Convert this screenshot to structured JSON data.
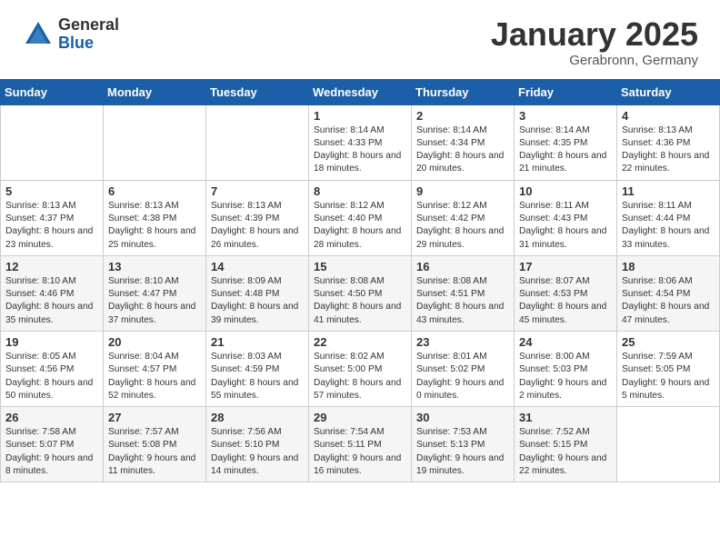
{
  "header": {
    "logo_general": "General",
    "logo_blue": "Blue",
    "month": "January 2025",
    "location": "Gerabronn, Germany"
  },
  "days_of_week": [
    "Sunday",
    "Monday",
    "Tuesday",
    "Wednesday",
    "Thursday",
    "Friday",
    "Saturday"
  ],
  "weeks": [
    [
      {
        "num": "",
        "info": ""
      },
      {
        "num": "",
        "info": ""
      },
      {
        "num": "",
        "info": ""
      },
      {
        "num": "1",
        "info": "Sunrise: 8:14 AM\nSunset: 4:33 PM\nDaylight: 8 hours and 18 minutes."
      },
      {
        "num": "2",
        "info": "Sunrise: 8:14 AM\nSunset: 4:34 PM\nDaylight: 8 hours and 20 minutes."
      },
      {
        "num": "3",
        "info": "Sunrise: 8:14 AM\nSunset: 4:35 PM\nDaylight: 8 hours and 21 minutes."
      },
      {
        "num": "4",
        "info": "Sunrise: 8:13 AM\nSunset: 4:36 PM\nDaylight: 8 hours and 22 minutes."
      }
    ],
    [
      {
        "num": "5",
        "info": "Sunrise: 8:13 AM\nSunset: 4:37 PM\nDaylight: 8 hours and 23 minutes."
      },
      {
        "num": "6",
        "info": "Sunrise: 8:13 AM\nSunset: 4:38 PM\nDaylight: 8 hours and 25 minutes."
      },
      {
        "num": "7",
        "info": "Sunrise: 8:13 AM\nSunset: 4:39 PM\nDaylight: 8 hours and 26 minutes."
      },
      {
        "num": "8",
        "info": "Sunrise: 8:12 AM\nSunset: 4:40 PM\nDaylight: 8 hours and 28 minutes."
      },
      {
        "num": "9",
        "info": "Sunrise: 8:12 AM\nSunset: 4:42 PM\nDaylight: 8 hours and 29 minutes."
      },
      {
        "num": "10",
        "info": "Sunrise: 8:11 AM\nSunset: 4:43 PM\nDaylight: 8 hours and 31 minutes."
      },
      {
        "num": "11",
        "info": "Sunrise: 8:11 AM\nSunset: 4:44 PM\nDaylight: 8 hours and 33 minutes."
      }
    ],
    [
      {
        "num": "12",
        "info": "Sunrise: 8:10 AM\nSunset: 4:46 PM\nDaylight: 8 hours and 35 minutes."
      },
      {
        "num": "13",
        "info": "Sunrise: 8:10 AM\nSunset: 4:47 PM\nDaylight: 8 hours and 37 minutes."
      },
      {
        "num": "14",
        "info": "Sunrise: 8:09 AM\nSunset: 4:48 PM\nDaylight: 8 hours and 39 minutes."
      },
      {
        "num": "15",
        "info": "Sunrise: 8:08 AM\nSunset: 4:50 PM\nDaylight: 8 hours and 41 minutes."
      },
      {
        "num": "16",
        "info": "Sunrise: 8:08 AM\nSunset: 4:51 PM\nDaylight: 8 hours and 43 minutes."
      },
      {
        "num": "17",
        "info": "Sunrise: 8:07 AM\nSunset: 4:53 PM\nDaylight: 8 hours and 45 minutes."
      },
      {
        "num": "18",
        "info": "Sunrise: 8:06 AM\nSunset: 4:54 PM\nDaylight: 8 hours and 47 minutes."
      }
    ],
    [
      {
        "num": "19",
        "info": "Sunrise: 8:05 AM\nSunset: 4:56 PM\nDaylight: 8 hours and 50 minutes."
      },
      {
        "num": "20",
        "info": "Sunrise: 8:04 AM\nSunset: 4:57 PM\nDaylight: 8 hours and 52 minutes."
      },
      {
        "num": "21",
        "info": "Sunrise: 8:03 AM\nSunset: 4:59 PM\nDaylight: 8 hours and 55 minutes."
      },
      {
        "num": "22",
        "info": "Sunrise: 8:02 AM\nSunset: 5:00 PM\nDaylight: 8 hours and 57 minutes."
      },
      {
        "num": "23",
        "info": "Sunrise: 8:01 AM\nSunset: 5:02 PM\nDaylight: 9 hours and 0 minutes."
      },
      {
        "num": "24",
        "info": "Sunrise: 8:00 AM\nSunset: 5:03 PM\nDaylight: 9 hours and 2 minutes."
      },
      {
        "num": "25",
        "info": "Sunrise: 7:59 AM\nSunset: 5:05 PM\nDaylight: 9 hours and 5 minutes."
      }
    ],
    [
      {
        "num": "26",
        "info": "Sunrise: 7:58 AM\nSunset: 5:07 PM\nDaylight: 9 hours and 8 minutes."
      },
      {
        "num": "27",
        "info": "Sunrise: 7:57 AM\nSunset: 5:08 PM\nDaylight: 9 hours and 11 minutes."
      },
      {
        "num": "28",
        "info": "Sunrise: 7:56 AM\nSunset: 5:10 PM\nDaylight: 9 hours and 14 minutes."
      },
      {
        "num": "29",
        "info": "Sunrise: 7:54 AM\nSunset: 5:11 PM\nDaylight: 9 hours and 16 minutes."
      },
      {
        "num": "30",
        "info": "Sunrise: 7:53 AM\nSunset: 5:13 PM\nDaylight: 9 hours and 19 minutes."
      },
      {
        "num": "31",
        "info": "Sunrise: 7:52 AM\nSunset: 5:15 PM\nDaylight: 9 hours and 22 minutes."
      },
      {
        "num": "",
        "info": ""
      }
    ]
  ]
}
